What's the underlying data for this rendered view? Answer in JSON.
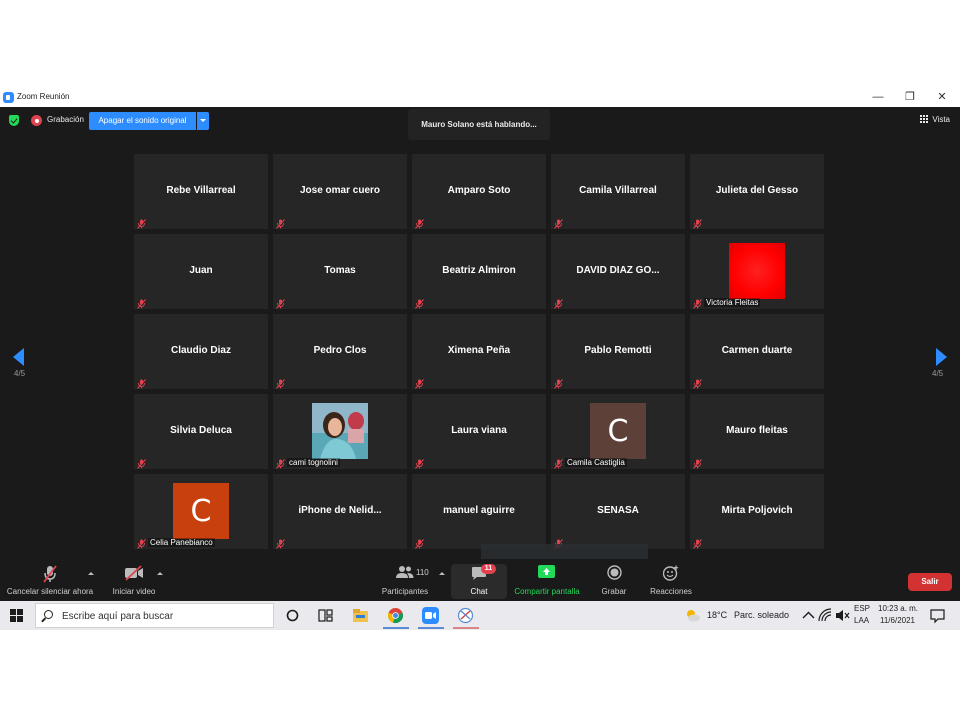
{
  "window": {
    "title": "Zoom Reunión",
    "controls": {
      "minimize": "—",
      "restore": "❐",
      "close": "✕"
    }
  },
  "topbar": {
    "recording_label": "Grabación",
    "original_sound_button": "Apagar el sonido original",
    "speaking_banner": "Mauro Solano está hablando...",
    "view_label": "Vista"
  },
  "pagination": {
    "left": "4/5",
    "right": "4/5"
  },
  "participants": [
    {
      "name": "Rebe Villarreal",
      "type": "name"
    },
    {
      "name": "Jose omar cuero",
      "type": "name"
    },
    {
      "name": "Amparo Soto",
      "type": "name"
    },
    {
      "name": "Camila Villarreal",
      "type": "name"
    },
    {
      "name": "Julieta del Gesso",
      "type": "name"
    },
    {
      "name": "Juan",
      "type": "name"
    },
    {
      "name": "Tomas",
      "type": "name"
    },
    {
      "name": "Beatriz Almiron",
      "type": "name"
    },
    {
      "name": "DAVID DIAZ GO...",
      "type": "name"
    },
    {
      "name": "Victoria Fleitas",
      "type": "color",
      "color": "#ff0000"
    },
    {
      "name": "Claudio Diaz",
      "type": "name"
    },
    {
      "name": "Pedro Clos",
      "type": "name"
    },
    {
      "name": "Ximena Peña",
      "type": "name"
    },
    {
      "name": "Pablo Remotti",
      "type": "name"
    },
    {
      "name": "Carmen duarte",
      "type": "name"
    },
    {
      "name": "Silvia Deluca",
      "type": "name"
    },
    {
      "name": "cami tognolini",
      "type": "photo"
    },
    {
      "name": "Laura viana",
      "type": "name"
    },
    {
      "name": "Camila Castiglia",
      "type": "avatar",
      "letter": "C",
      "color": "#5d4037"
    },
    {
      "name": "Mauro fleitas",
      "type": "name"
    },
    {
      "name": "Celia Panebianco",
      "type": "avatar",
      "letter": "C",
      "color": "#c9400f"
    },
    {
      "name": "iPhone  de  Nelid...",
      "type": "name"
    },
    {
      "name": "manuel aguirre",
      "type": "name"
    },
    {
      "name": "SENASA",
      "type": "name"
    },
    {
      "name": "Mirta Poljovich",
      "type": "name"
    }
  ],
  "toolbar": {
    "unmute_label": "Cancelar silenciar ahora",
    "video_label": "Iniciar video",
    "participants_label": "Participantes",
    "participants_count": "110",
    "chat_label": "Chat",
    "chat_badge": "11",
    "share_label": "Compartir pantalla",
    "record_label": "Grabar",
    "reactions_label": "Reacciones",
    "leave_label": "Salir"
  },
  "taskbar": {
    "search_placeholder": "Escribe aquí para buscar",
    "weather_temp": "18°C",
    "weather_text": "Parc. soleado",
    "lang_top": "ESP",
    "lang_bottom": "LAA",
    "time": "10:23 a. m.",
    "date": "11/6/2021"
  },
  "colors": {
    "accent": "#2d8cff",
    "meeting_bg": "#1a1a1a",
    "tile_bg": "#262626",
    "muted_mic": "#e0434f",
    "leave": "#d33232",
    "share_green": "#23d959"
  }
}
